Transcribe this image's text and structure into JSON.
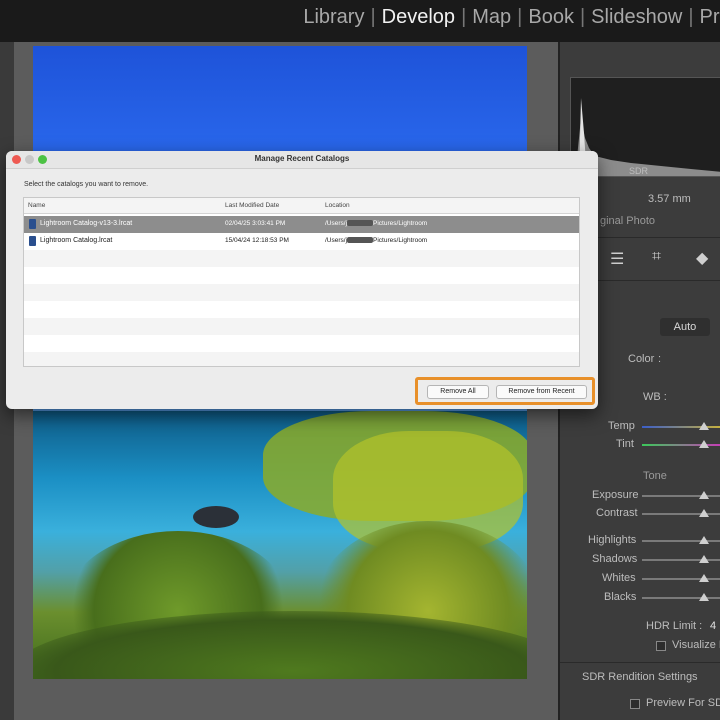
{
  "topbar": {
    "modules": [
      {
        "label": "Library",
        "active": false
      },
      {
        "label": "Develop",
        "active": true
      },
      {
        "label": "Map",
        "active": false
      },
      {
        "label": "Book",
        "active": false
      },
      {
        "label": "Slideshow",
        "active": false
      },
      {
        "label": "Pri",
        "active": false
      }
    ],
    "separator": "|"
  },
  "panel": {
    "histogram_label": "SDR",
    "focal_length": "3.57 mm",
    "original_photo": "ginal Photo",
    "auto_label": "Auto",
    "color_label": "Color",
    "wb_label": "WB :",
    "temp_label": "Temp",
    "tint_label": "Tint",
    "tone_label": "Tone",
    "exposure_label": "Exposure",
    "contrast_label": "Contrast",
    "highlights_label": "Highlights",
    "shadows_label": "Shadows",
    "whites_label": "Whites",
    "blacks_label": "Blacks",
    "hdr_limit_label": "HDR Limit :",
    "hdr_limit_value": "4",
    "visualize_label": "Visualize H",
    "sdr_rendition_label": "SDR Rendition Settings",
    "preview_label": "Preview For SD"
  },
  "dialog": {
    "title": "Manage Recent Catalogs",
    "instruction": "Select the catalogs you want to remove.",
    "columns": [
      "Name",
      "Last Modified Date",
      "Location"
    ],
    "rows": [
      {
        "name": "Lightroom Catalog-v13-3.lrcat",
        "modified": "02/04/25 3:03:41 PM",
        "location_prefix": "/Users/j",
        "location_suffix": "Pictures/Lightroom",
        "selected": true
      },
      {
        "name": "Lightroom Catalog.lrcat",
        "modified": "15/04/24 12:18:53 PM",
        "location_prefix": "/Users/j",
        "location_suffix": "Pictures/Lightroom",
        "selected": false
      }
    ],
    "remove_all_label": "Remove All",
    "remove_recent_label": "Remove from Recent",
    "highlight_color": "#e8902a"
  }
}
